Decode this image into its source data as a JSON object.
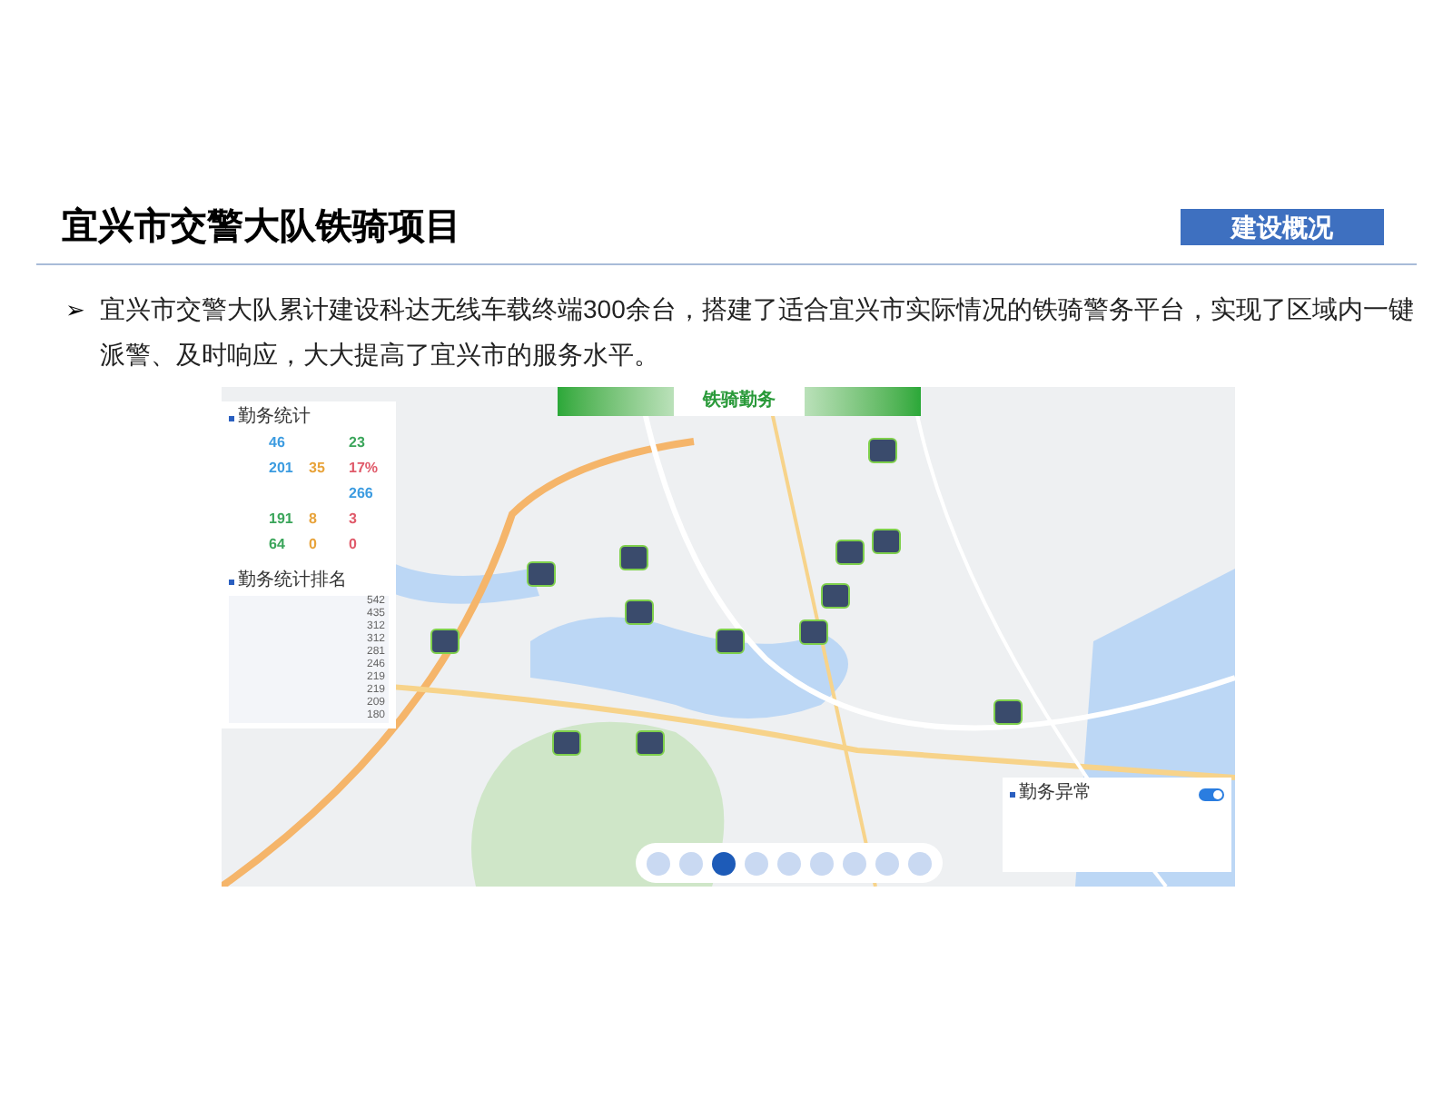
{
  "title": "宜兴市交警大队铁骑项目",
  "section_badge": "建设概况",
  "bullet": {
    "marker": "➢",
    "text": "宜兴市交警大队累计建设科达无线车载终端300余台，搭建了适合宜兴市实际情况的铁骑警务平台，实现了区域内一键派警、及时响应，大大提高了宜兴市的服务水平。"
  },
  "app": {
    "banner": "铁骑勤务",
    "stats_panel": {
      "title": "勤务统计",
      "rows": [
        [
          {
            "value": "46",
            "color": "#3b9be0"
          },
          null,
          {
            "value": "23",
            "color": "#3aa55a"
          }
        ],
        [
          {
            "value": "201",
            "color": "#3b9be0"
          },
          {
            "value": "35",
            "color": "#e8a33a"
          },
          {
            "value": "17%",
            "color": "#e05a6a"
          }
        ],
        [
          null,
          null,
          {
            "value": "266",
            "color": "#3b9be0"
          }
        ],
        [
          {
            "value": "191",
            "color": "#3aa55a"
          },
          {
            "value": "8",
            "color": "#e8a33a"
          },
          {
            "value": "3",
            "color": "#e05a6a"
          }
        ],
        [
          {
            "value": "64",
            "color": "#3aa55a"
          },
          {
            "value": "0",
            "color": "#e8a33a"
          },
          {
            "value": "0",
            "color": "#e05a6a"
          }
        ]
      ]
    },
    "ranking_panel": {
      "title": "勤务统计排名",
      "values": [
        "542",
        "435",
        "312",
        "312",
        "281",
        "246",
        "219",
        "219",
        "209",
        "180"
      ]
    },
    "alarm_panel": {
      "title": "勤务异常",
      "toggle_on": true
    },
    "toolbar": [
      {
        "selected": false
      },
      {
        "selected": false
      },
      {
        "selected": true
      },
      {
        "selected": false
      },
      {
        "selected": false
      },
      {
        "selected": false
      },
      {
        "selected": false
      },
      {
        "selected": false
      },
      {
        "selected": false
      }
    ]
  }
}
